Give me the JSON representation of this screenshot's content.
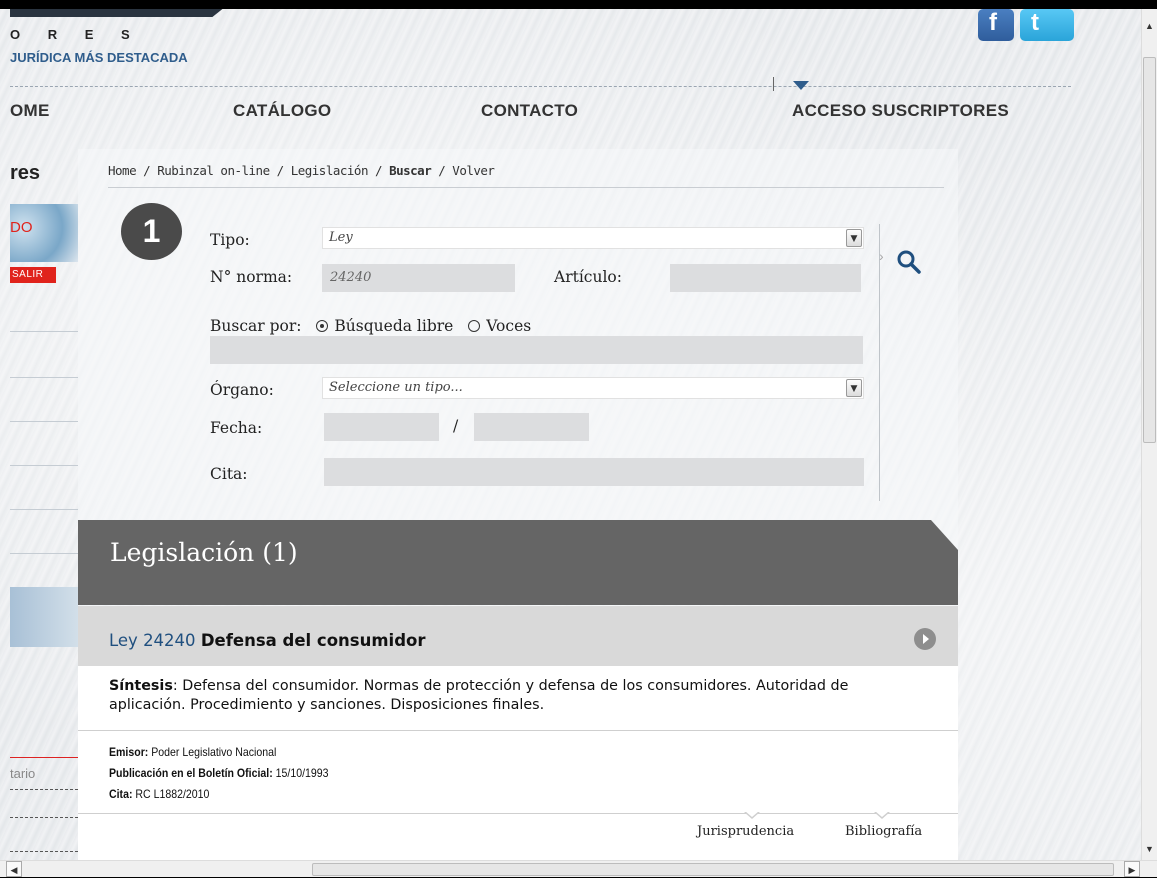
{
  "header": {
    "logo_letters": "O R E S",
    "tagline": "JURÍDICA MÁS DESTACADA",
    "social": [
      {
        "icon": "facebook-icon",
        "glyph": "f"
      },
      {
        "icon": "twitter-icon",
        "glyph": "t"
      }
    ]
  },
  "nav": {
    "home": "OME",
    "catalogo": "CATÁLOGO",
    "contacto": "CONTACTO",
    "acceso": "ACCESO SUSCRIPTORES"
  },
  "sidebar": {
    "title": "res",
    "red_text": "DO",
    "salir": "SALIR",
    "tario": "tario"
  },
  "breadcrumb": {
    "home": "Home",
    "online": "Rubinzal on-line",
    "legislacion": "Legislación",
    "buscar": "Buscar",
    "volver": "Volver",
    "separator": " / "
  },
  "form": {
    "step": "1",
    "tipo_label": "Tipo:",
    "tipo_value": "Ley",
    "norma_label": "N° norma:",
    "norma_value": "24240",
    "articulo_label": "Artículo:",
    "articulo_value": "",
    "buscar_por_label": "Buscar por:",
    "opt_libre": "Búsqueda libre",
    "opt_voces": "Voces",
    "selected_option": "Búsqueda libre",
    "organo_label": "Órgano:",
    "organo_value": "Seleccione un tipo...",
    "fecha_label": "Fecha:",
    "fecha_sep": "/",
    "cita_label": "Cita:"
  },
  "results": {
    "title": "Legislación (1)",
    "items": [
      {
        "law_number": "Ley 24240",
        "law_name": "Defensa del consumidor",
        "synth_label": "Síntesis",
        "synth_text": ": Defensa del consumidor. Normas de protección y defensa de los consumidores. Autoridad de aplicación. Procedimiento y sanciones. Disposiciones finales.",
        "emisor_label": "Emisor:",
        "emisor_value": "Poder Legislativo Nacional",
        "publicacion_label": "Publicación en el Boletín Oficial:",
        "publicacion_value": "15/10/1993",
        "cita_label": "Cita:",
        "cita_value": "RC L1882/2010",
        "tabs": [
          "Jurisprudencia",
          "Bibliografía"
        ]
      }
    ]
  },
  "colors": {
    "accent_blue": "#2f5d8c",
    "red": "#e0231c",
    "result_header": "#656565"
  }
}
